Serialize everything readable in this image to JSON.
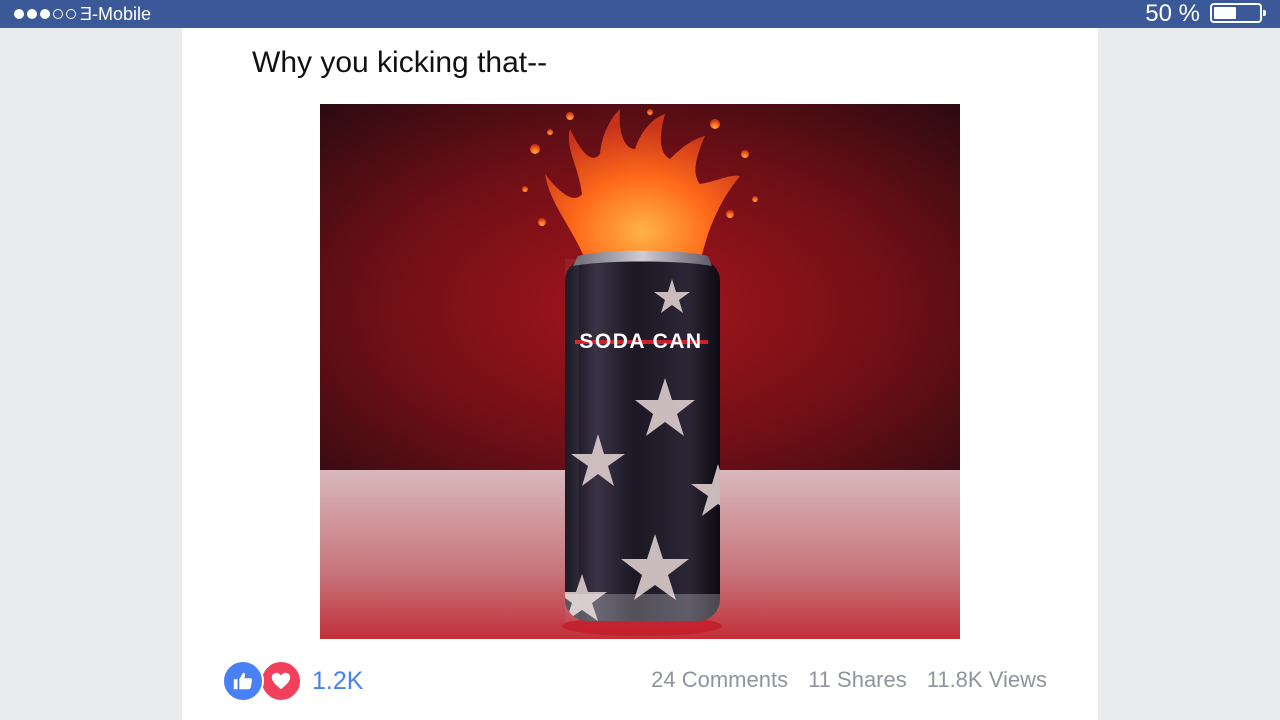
{
  "status_bar": {
    "signal_filled": 3,
    "signal_total": 5,
    "carrier": "Ǝ-Mobile",
    "battery_percent_label": "50 %",
    "battery_level": 0.5,
    "background_color": "#3b5998"
  },
  "post": {
    "text": "Why you kicking that--",
    "media": {
      "can_label": "SODA CAN",
      "stripe_color": "#d11f2a",
      "splash_color": "#ff6a1a"
    },
    "reactions": {
      "icons": [
        "like-icon",
        "love-icon"
      ],
      "count": "1.2K",
      "like_color": "#4a80f5",
      "love_color": "#f0405a"
    },
    "stats": {
      "comments": "24 Comments",
      "shares": "11 Shares",
      "views": "11.8K Views"
    }
  }
}
